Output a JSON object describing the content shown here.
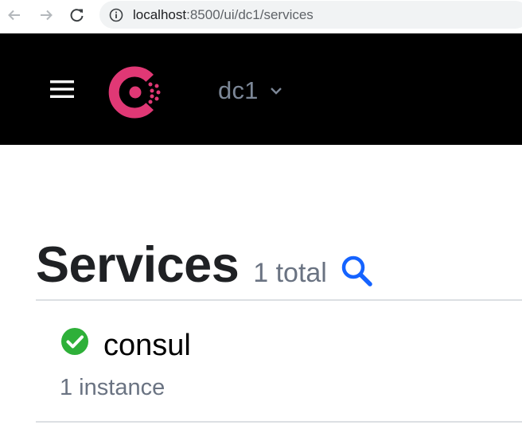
{
  "browser": {
    "url_host": "localhost",
    "url_rest": ":8500/ui/dc1/services",
    "icons": {
      "back": "arrow-left-icon",
      "forward": "arrow-right-icon",
      "reload": "reload-icon",
      "info": "info-icon"
    }
  },
  "header": {
    "background": "#000000",
    "logo_color": "#e03875",
    "menu_icon": "hamburger-menu-icon",
    "datacenter": "dc1",
    "datacenter_icon": "chevron-down-icon"
  },
  "main": {
    "title": "Services",
    "total": "1 total",
    "search_icon": "search-icon",
    "search_color": "#1563ff"
  },
  "services": [
    {
      "name": "consul",
      "status": "passing",
      "status_color": "#2eb039",
      "instances": "1 instance"
    }
  ]
}
